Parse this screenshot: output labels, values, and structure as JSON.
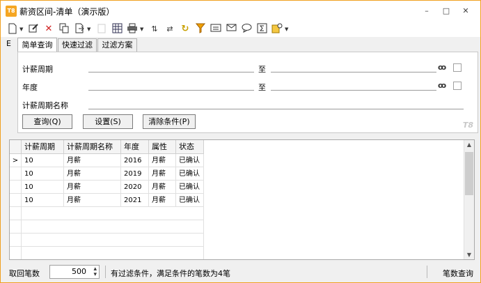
{
  "window": {
    "title": "薪资区间-清单（演示版）",
    "app_icon_text": "T8",
    "minimize": "–",
    "maximize": "□",
    "close": "✕"
  },
  "toolbar_icons": [
    "new-icon",
    "edit-icon",
    "delete-icon",
    "copy-icon",
    "export-icon",
    "refresh-icon",
    "layout-icon",
    "print-icon",
    "sort-icon",
    "filter-icon",
    "filter-red-icon",
    "funnel-icon",
    "list-icon",
    "mail-icon",
    "comment-icon",
    "sum-icon",
    "settings-icon"
  ],
  "left_marker": "E",
  "tabs": [
    {
      "label": "简单查询",
      "active": true
    },
    {
      "label": "快速过滤",
      "active": false
    },
    {
      "label": "过滤方案",
      "active": false
    }
  ],
  "query": {
    "fields": [
      {
        "label": "计薪周期",
        "to_label": "至",
        "from_value": "",
        "to_value": ""
      },
      {
        "label": "年度",
        "to_label": "至",
        "from_value": "",
        "to_value": ""
      },
      {
        "label": "计薪周期名称",
        "value": ""
      }
    ],
    "buttons": {
      "query": "查询(Q)",
      "settings": "设置(S)",
      "clear": "清除条件(P)"
    },
    "brand": "T8"
  },
  "grid": {
    "columns": [
      "计薪周期",
      "计薪周期名称",
      "年度",
      "属性",
      "状态"
    ],
    "rows": [
      [
        "10",
        "月薪",
        "2016",
        "月薪",
        "已确认"
      ],
      [
        "10",
        "月薪",
        "2019",
        "月薪",
        "已确认"
      ],
      [
        "10",
        "月薪",
        "2020",
        "月薪",
        "已确认"
      ],
      [
        "10",
        "月薪",
        "2021",
        "月薪",
        "已确认"
      ]
    ],
    "selected_row_marker": ">"
  },
  "statusbar": {
    "fetch_label": "取回笔数",
    "fetch_value": "500",
    "message": "有过滤条件，满足条件的笔数为4笔",
    "right_text": "笔数查询"
  },
  "colors": {
    "border_accent": "#f0a020"
  }
}
